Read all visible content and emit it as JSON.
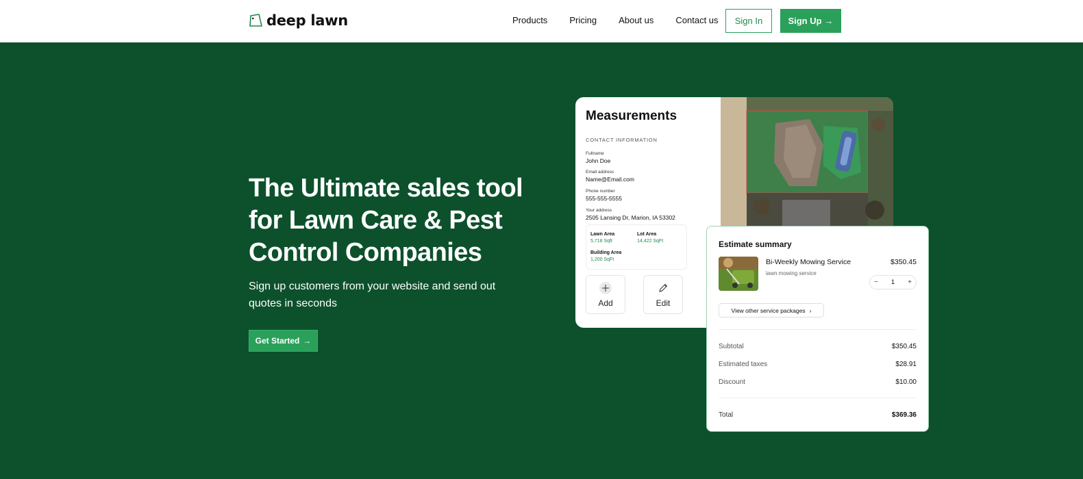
{
  "nav": {
    "logo_text": "deep lawn",
    "links": [
      "Products",
      "Pricing",
      "About us",
      "Contact us"
    ],
    "sign_in": "Sign In",
    "sign_up": "Sign Up",
    "arrow": "→"
  },
  "hero": {
    "title": "The Ultimate sales tool for Lawn Care & Pest Control Companies",
    "subtitle": "Sign up customers from your website and send out quotes in seconds",
    "cta": "Get Started"
  },
  "measurements": {
    "title": "Measurements",
    "section_label": "CONTACT INFORMATION",
    "fields": [
      {
        "label": "Fullname",
        "value": "John Doe"
      },
      {
        "label": "Email address",
        "value": "Name@Email.com"
      },
      {
        "label": "Phone number",
        "value": "555-555-5555"
      },
      {
        "label": "Your address",
        "value": "2505 Lansing Dr, Marion, IA 53302"
      }
    ],
    "areas": [
      {
        "name": "Lawn Area",
        "value": "5,718 Sqft"
      },
      {
        "name": "Lot Area",
        "value": "14,422 SqFt"
      },
      {
        "name": "Building Area",
        "value": "1,200 SqFt"
      }
    ],
    "add_label": "Add",
    "edit_label": "Edit"
  },
  "estimate": {
    "title": "Estimate summary",
    "service_name": "Bi-Weekly Mowing Service",
    "service_desc": "lawn mowing service",
    "service_price": "$350.45",
    "quantity": "1",
    "minus": "−",
    "plus": "+",
    "view_packages": "View other service packages",
    "chevron": "›",
    "rows": [
      {
        "label": "Subtotal",
        "value": "$350.45"
      },
      {
        "label": "Estimated taxes",
        "value": "$28.91"
      },
      {
        "label": "Discount",
        "value": "$10.00"
      }
    ],
    "total_label": "Total",
    "total_value": "$369.36"
  },
  "colors": {
    "hero_bg": "#0c512c",
    "accent": "#2aa05a"
  }
}
